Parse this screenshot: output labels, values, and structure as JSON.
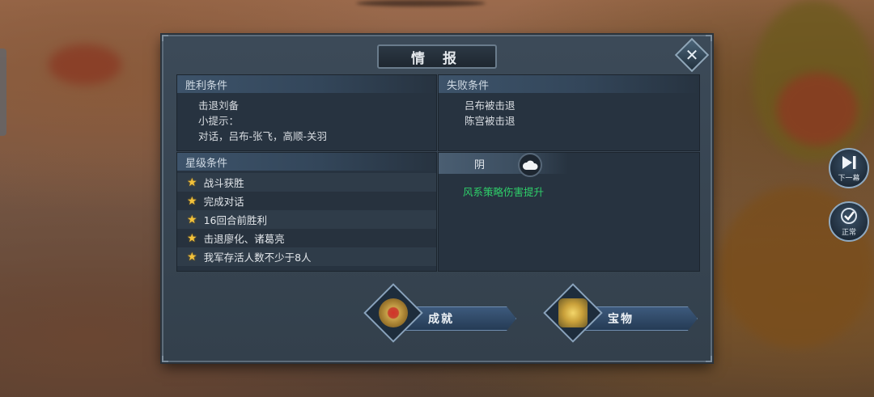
{
  "panel": {
    "title": "情 报",
    "close_icon": "close-icon"
  },
  "victory": {
    "header": "胜利条件",
    "lines": [
      "击退刘备",
      "小提示：",
      "对话，吕布-张飞，高顺-关羽"
    ]
  },
  "defeat": {
    "header": "失败条件",
    "lines": [
      "吕布被击退",
      "陈宫被击退"
    ]
  },
  "stars": {
    "header": "星级条件",
    "items": [
      "战斗获胜",
      "完成对话",
      "16回合前胜利",
      "击退廖化、诸葛亮",
      "我军存活人数不少于8人"
    ],
    "star_color": "#f2c23c"
  },
  "weather": {
    "label": "阴",
    "icon": "cloud-icon",
    "effect": "风系策略伤害提升",
    "effect_color": "#2fd06a"
  },
  "buttons": {
    "achievement": "成就",
    "treasure": "宝物"
  },
  "side": {
    "next_label": "下一幕",
    "normal_label": "正常"
  }
}
